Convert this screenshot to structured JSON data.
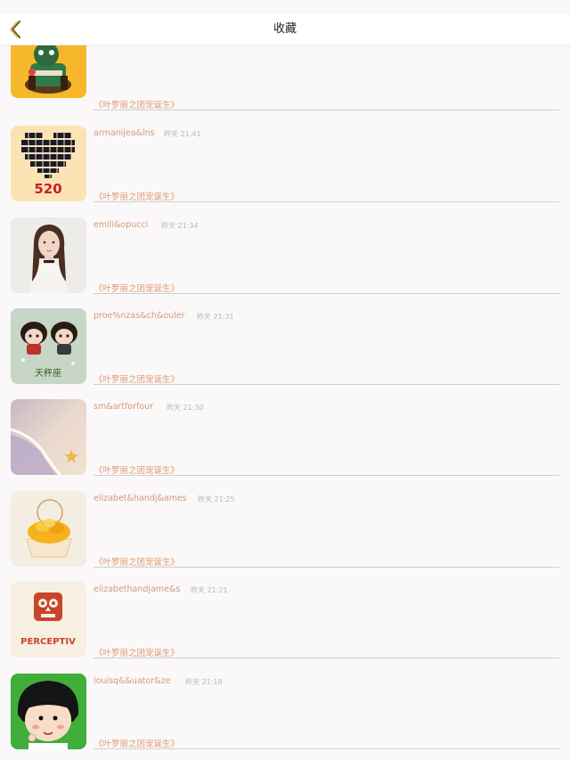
{
  "nav": {
    "title": "收藏",
    "back_icon": "chevron-left-icon",
    "accent_color": "#8a6a1a"
  },
  "items": [
    {
      "user": "",
      "time": "",
      "title": "《叶罗丽之团宠诞生》",
      "thumb": "cartoon-character-yellow"
    },
    {
      "user": "armanijea&lns",
      "time": "昨天 21:41",
      "title": "《叶罗丽之团宠诞生》",
      "thumb": "pixel-heart-520"
    },
    {
      "user": "emili&opucci",
      "time": "昨天 21:34",
      "title": "《叶罗丽之团宠诞生》",
      "thumb": "portrait-girl"
    },
    {
      "user": "proe%nzas&ch&ouler",
      "time": "昨天 21:31",
      "title": "《叶罗丽之团宠诞生》",
      "thumb": "cartoon-couple"
    },
    {
      "user": "sm&artforfour",
      "time": "昨天 21:30",
      "title": "《叶罗丽之团宠诞生》",
      "thumb": "beach-starfish"
    },
    {
      "user": "elizabet&handj&ames",
      "time": "昨天 21:25",
      "title": "《叶罗丽之团宠诞生》",
      "thumb": "cupcake"
    },
    {
      "user": "elizabethandjame&s",
      "time": "昨天 21:21",
      "title": "《叶罗丽之团宠诞生》",
      "thumb": "perceptiv-owl-logo"
    },
    {
      "user": "louisq&&uator&ze",
      "time": "昨天 21:18",
      "title": "《叶罗丽之团宠诞生》",
      "thumb": "cartoon-girl-green"
    }
  ],
  "logo_text": "PERCEPTIV",
  "heart_text": "520",
  "couple_text": "天秤座"
}
